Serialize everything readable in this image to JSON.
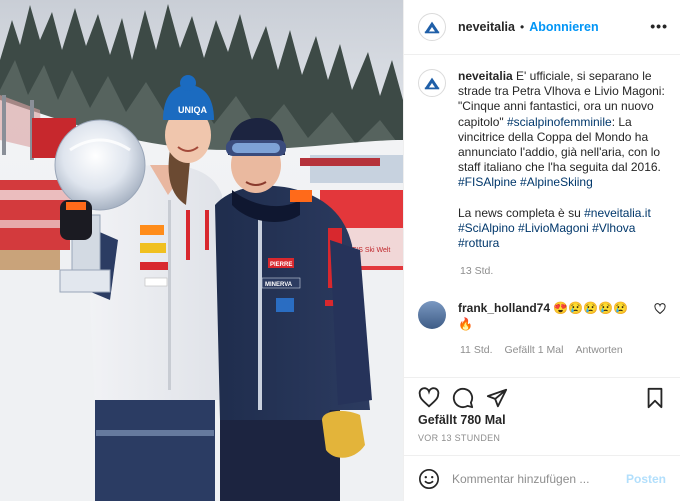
{
  "photo": {
    "description_icons": [
      "trophy-globe",
      "skier-woman",
      "skier-man"
    ],
    "hat_text": "UNIQA",
    "banner_text": "FIS Ski Welt",
    "badge_text": "MINERVA",
    "badge2_text": "PIERRE",
    "brand_text": "OGG"
  },
  "header": {
    "username": "neveitalia",
    "separator": "•",
    "follow_label": "Abonnieren",
    "more_label": "•••"
  },
  "caption": {
    "username": "neveitalia",
    "text1": "E' ufficiale, si separano le strade tra Petra Vlhova e Livio Magoni: \"Cinque anni fantastici, ora un nuovo capitolo\"",
    "tag1": "#scialpinofemminile",
    "text2": ": La vincitrice della Coppa del Mondo ha annunciato l'addio, già nell'aria, con lo staff italiano che l'ha seguita dal 2016.",
    "tags2": "#FISAlpine #AlpineSkiing",
    "text3": "La news completa è su",
    "tag3": "#neveitalia.it",
    "tags4": "#SciAlpino #LivioMagoni #Vlhova #rottura",
    "age": "13 Std."
  },
  "comment": {
    "username": "frank_holland74",
    "emojis": "😍😢😢😢😢",
    "emoji2": "🔥",
    "age": "11 Std.",
    "likes": "Gefällt 1 Mal",
    "reply": "Antworten"
  },
  "actions": {
    "likes": "Gefällt 780 Mal",
    "time": "VOR 13 STUNDEN"
  },
  "add_comment": {
    "placeholder": "Kommentar hinzufügen ...",
    "post_label": "Posten"
  },
  "colors": {
    "accent": "#0095f6",
    "tag": "#00376b",
    "muted": "#8e8e8e"
  }
}
